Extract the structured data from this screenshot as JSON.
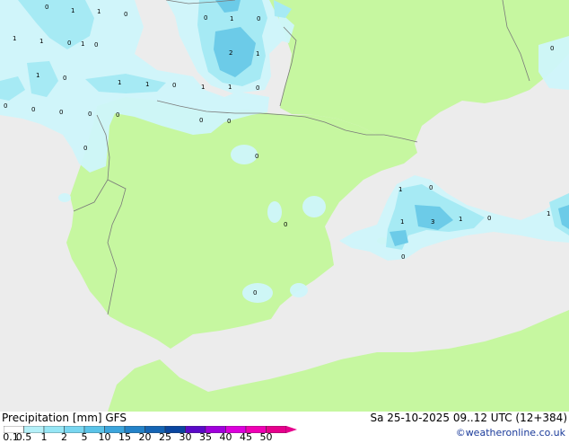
{
  "footer": {
    "title": "Precipitation [mm]  GFS",
    "datetime": "Sa 25-10-2025 09..12 UTC (12+384)",
    "credit": "©weatheronline.co.uk"
  },
  "legend": {
    "ticks": [
      "0.1",
      "0.5",
      "1",
      "2",
      "5",
      "10",
      "15",
      "20",
      "25",
      "30",
      "35",
      "40",
      "45",
      "50"
    ],
    "colors": [
      "#ffffff",
      "#b4f0f8",
      "#96e6f5",
      "#78d6f0",
      "#5ac3e8",
      "#3ca5dc",
      "#2382c8",
      "#1464b4",
      "#0a46a0",
      "#5a0ac8",
      "#a000dc",
      "#dc00dc",
      "#f000b4",
      "#e6008c"
    ]
  },
  "map": {
    "colors": {
      "sea": "#ececec",
      "land": "#c6f7a0",
      "precip_light": "#cff6fb",
      "precip_mid": "#a6eaf4",
      "precip_strong": "#6ccbe8"
    },
    "contour_labels": [
      "0",
      "1",
      "1",
      "0",
      "1",
      "1",
      "0",
      "0",
      "1",
      "0",
      "0",
      "1",
      "2",
      "1",
      "0",
      "1",
      "0",
      "1",
      "1",
      "0",
      "0",
      "0",
      "1",
      "1",
      "0",
      "0",
      "0",
      "0",
      "0",
      "0",
      "0",
      "0",
      "0",
      "1",
      "0",
      "1",
      "3",
      "1",
      "0",
      "0",
      "1",
      "0"
    ]
  }
}
